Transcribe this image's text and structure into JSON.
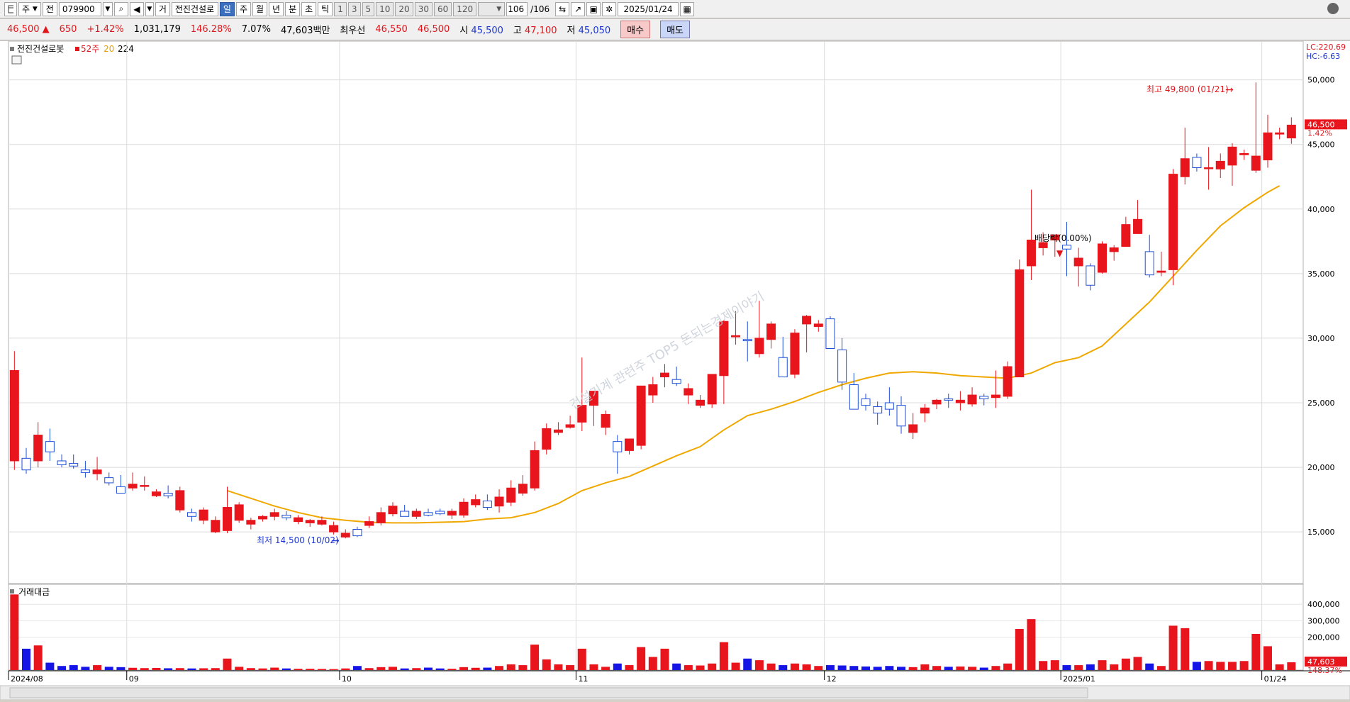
{
  "toolbar": {
    "mode1": "주",
    "mode2": "전",
    "code": "079900",
    "kind": "거",
    "name": "전진건설로",
    "periods": [
      "일",
      "주",
      "월",
      "년",
      "분",
      "초",
      "틱"
    ],
    "selected_period": "일",
    "minute_options": [
      "1",
      "3",
      "5",
      "10",
      "20",
      "30",
      "60",
      "120"
    ],
    "count": "106",
    "count_total": "/106",
    "date": "2025/01/24"
  },
  "quote": {
    "price": "46,500",
    "arrow": "▲",
    "change": "650",
    "change_pct": "+1.42%",
    "volume": "1,031,179",
    "volume_pct": "146.28%",
    "turnover_pct": "7.07%",
    "amount": "47,603백만",
    "best_label": "최우선",
    "best_ask": "46,550",
    "best_bid": "46,500",
    "open_label": "시",
    "open": "45,500",
    "high_label": "고",
    "high": "47,100",
    "low_label": "저",
    "low": "45,050",
    "buy_label": "매수",
    "sell_label": "매도"
  },
  "legend": {
    "name": "전진건설로봇",
    "ma1": "52주",
    "ma2": "20",
    "ma3": "224"
  },
  "labels": {
    "lc": "LC:220.69",
    "hc": "HC:-6.63",
    "last_price": "46,500",
    "last_pct": "1.42%",
    "max_note": "최고 49,800 (01/21)",
    "min_note": "최저 14,500 (10/02)",
    "dividend": "배당락(0.00%)",
    "watermark": "건설기계 관련주 TOP5 돈되는경제이야기",
    "volume_title": "거래대금",
    "vol_last": "47,603",
    "vol_pct": "148.37%"
  },
  "chart_data": {
    "type": "candlestick",
    "price_ticks": [
      15000,
      20000,
      25000,
      30000,
      35000,
      40000,
      45000,
      50000
    ],
    "price_tick_labels": [
      "15,000",
      "20,000",
      "25,000",
      "30,000",
      "35,000",
      "40,000",
      "45,000",
      "50,000"
    ],
    "ylim": [
      11000,
      53000
    ],
    "volume_ticks": [
      200000,
      300000,
      400000
    ],
    "volume_tick_labels": [
      "200,000",
      "300,000",
      "400,000"
    ],
    "volume_ylim": [
      0,
      470000
    ],
    "x_labels": [
      {
        "index": 0,
        "label": "2024/08"
      },
      {
        "index": 10,
        "label": "09"
      },
      {
        "index": 28,
        "label": "10"
      },
      {
        "index": 48,
        "label": "11"
      },
      {
        "index": 69,
        "label": "12"
      },
      {
        "index": 89,
        "label": "2025/01"
      },
      {
        "index": 106,
        "label": "01/24"
      }
    ],
    "candles": [
      [
        20500,
        29000,
        19800,
        27500,
        460000
      ],
      [
        20700,
        21500,
        19500,
        19800,
        130000
      ],
      [
        20500,
        23500,
        20000,
        22500,
        150000
      ],
      [
        22000,
        23000,
        20500,
        21200,
        45000
      ],
      [
        20500,
        21000,
        20000,
        20200,
        25000
      ],
      [
        20300,
        21000,
        19900,
        20100,
        30000
      ],
      [
        19800,
        20500,
        19200,
        19600,
        20000
      ],
      [
        19500,
        20800,
        19000,
        19800,
        30000
      ],
      [
        19200,
        19600,
        18600,
        18800,
        20000
      ],
      [
        18500,
        19400,
        18000,
        18000,
        18000
      ],
      [
        18400,
        19600,
        18200,
        18700,
        14000
      ],
      [
        18600,
        19300,
        18200,
        18600,
        12000
      ],
      [
        17800,
        18300,
        17700,
        18100,
        13000
      ],
      [
        18000,
        18600,
        17600,
        17800,
        11000
      ],
      [
        16700,
        18500,
        16500,
        18200,
        12000
      ],
      [
        16500,
        16800,
        15800,
        16200,
        10000
      ],
      [
        15900,
        16900,
        15600,
        16700,
        11000
      ],
      [
        15000,
        16200,
        14900,
        15900,
        12000
      ],
      [
        15100,
        18500,
        14900,
        16900,
        70000
      ],
      [
        15900,
        17300,
        15700,
        17100,
        20000
      ],
      [
        15600,
        16100,
        15200,
        15900,
        12000
      ],
      [
        16000,
        16300,
        15800,
        16200,
        10000
      ],
      [
        16200,
        16800,
        15900,
        16500,
        15000
      ],
      [
        16300,
        16600,
        15900,
        16100,
        10000
      ],
      [
        15800,
        16300,
        15600,
        16100,
        8000
      ],
      [
        15700,
        16000,
        15400,
        15900,
        8000
      ],
      [
        15600,
        16200,
        15500,
        15900,
        7000
      ],
      [
        15000,
        15800,
        14800,
        15500,
        6000
      ],
      [
        14600,
        15200,
        14500,
        14900,
        10000
      ],
      [
        15200,
        15400,
        14600,
        14700,
        25000
      ],
      [
        15500,
        16200,
        15300,
        15800,
        12000
      ],
      [
        15700,
        16900,
        15500,
        16500,
        18000
      ],
      [
        16400,
        17300,
        16200,
        17000,
        20000
      ],
      [
        16600,
        17100,
        16300,
        16200,
        10000
      ],
      [
        16200,
        16800,
        16000,
        16600,
        12000
      ],
      [
        16500,
        16800,
        16200,
        16300,
        15000
      ],
      [
        16600,
        16800,
        16300,
        16400,
        10000
      ],
      [
        16300,
        16800,
        16000,
        16600,
        8000
      ],
      [
        16300,
        17600,
        16100,
        17300,
        18000
      ],
      [
        17100,
        17900,
        16900,
        17500,
        14000
      ],
      [
        17400,
        17900,
        16700,
        16900,
        15000
      ],
      [
        17000,
        18300,
        16500,
        17700,
        25000
      ],
      [
        17300,
        19000,
        17000,
        18400,
        35000
      ],
      [
        18000,
        19400,
        17800,
        18700,
        30000
      ],
      [
        18400,
        22000,
        18200,
        21300,
        155000
      ],
      [
        21400,
        23400,
        21000,
        23000,
        65000
      ],
      [
        22700,
        23500,
        22500,
        22900,
        35000
      ],
      [
        23100,
        24000,
        23000,
        23300,
        30000
      ],
      [
        23500,
        28500,
        22800,
        24800,
        130000
      ],
      [
        24800,
        25400,
        23200,
        25900,
        35000
      ],
      [
        23100,
        24400,
        22500,
        24100,
        20000
      ],
      [
        22000,
        22500,
        19500,
        21200,
        40000
      ],
      [
        21300,
        22000,
        21000,
        22200,
        30000
      ],
      [
        21700,
        26000,
        21400,
        26300,
        140000
      ],
      [
        25600,
        27000,
        25000,
        26400,
        80000
      ],
      [
        27000,
        28000,
        26200,
        27300,
        130000
      ],
      [
        26800,
        27800,
        26300,
        26500,
        40000
      ],
      [
        25600,
        26500,
        24900,
        26100,
        30000
      ],
      [
        24800,
        25600,
        24600,
        25200,
        28000
      ],
      [
        24900,
        27000,
        24600,
        27200,
        40000
      ],
      [
        27100,
        31400,
        24900,
        31300,
        170000
      ],
      [
        30100,
        32100,
        29500,
        30200,
        45000
      ],
      [
        29900,
        31300,
        28200,
        29800,
        70000
      ],
      [
        28800,
        32900,
        28500,
        30000,
        60000
      ],
      [
        29900,
        31300,
        29200,
        31100,
        40000
      ],
      [
        28500,
        30100,
        27400,
        27000,
        30000
      ],
      [
        27200,
        30700,
        26900,
        30400,
        40000
      ],
      [
        31100,
        31800,
        28900,
        31700,
        35000
      ],
      [
        30900,
        31400,
        30500,
        31100,
        25000
      ],
      [
        31500,
        31700,
        29800,
        29200,
        30000
      ],
      [
        29100,
        30000,
        26000,
        26600,
        28000
      ],
      [
        26400,
        27300,
        24600,
        24500,
        25000
      ],
      [
        25300,
        25700,
        24400,
        24800,
        22000
      ],
      [
        24700,
        25100,
        23300,
        24200,
        20000
      ],
      [
        25000,
        26200,
        24000,
        24500,
        25000
      ],
      [
        24800,
        25500,
        22600,
        23200,
        20000
      ],
      [
        22700,
        24200,
        22200,
        23300,
        18000
      ],
      [
        24200,
        24900,
        23500,
        24600,
        35000
      ],
      [
        24900,
        25300,
        24500,
        25200,
        25000
      ],
      [
        25300,
        25700,
        24600,
        25200,
        20000
      ],
      [
        25000,
        25900,
        24400,
        25200,
        22000
      ],
      [
        24900,
        26200,
        24700,
        25600,
        20000
      ],
      [
        25500,
        25700,
        24800,
        25300,
        15000
      ],
      [
        25400,
        27500,
        24600,
        25600,
        25000
      ],
      [
        25500,
        28200,
        25300,
        27800,
        40000
      ],
      [
        27000,
        36100,
        27000,
        35300,
        250000
      ],
      [
        35600,
        41500,
        34500,
        37600,
        310000
      ],
      [
        37000,
        38200,
        36400,
        37400,
        55000
      ],
      [
        37600,
        37900,
        36300,
        38000,
        60000
      ],
      [
        37200,
        39000,
        34800,
        36900,
        30000
      ],
      [
        35600,
        37000,
        34000,
        36200,
        30000
      ],
      [
        35600,
        35800,
        33700,
        34100,
        35000
      ],
      [
        35100,
        37500,
        35000,
        37300,
        60000
      ],
      [
        36700,
        37200,
        36000,
        37000,
        35000
      ],
      [
        37100,
        39400,
        37200,
        38800,
        70000
      ],
      [
        38100,
        40700,
        38300,
        39200,
        80000
      ],
      [
        36700,
        38000,
        34700,
        34900,
        40000
      ],
      [
        35100,
        36700,
        34800,
        35200,
        25000
      ],
      [
        35300,
        43100,
        34100,
        42700,
        270000
      ],
      [
        42500,
        46300,
        41900,
        43900,
        255000
      ],
      [
        44000,
        44300,
        42900,
        43200,
        50000
      ],
      [
        43200,
        44800,
        41500,
        43200,
        55000
      ],
      [
        43100,
        44300,
        42400,
        43700,
        50000
      ],
      [
        43400,
        45100,
        41800,
        44800,
        50000
      ],
      [
        44200,
        44600,
        43800,
        44300,
        55000
      ],
      [
        43000,
        49800,
        42800,
        44100,
        220000
      ],
      [
        43800,
        47300,
        43200,
        45900,
        145000
      ],
      [
        45800,
        46300,
        45400,
        45900,
        35000
      ],
      [
        45500,
        47100,
        45050,
        46500,
        47603
      ]
    ],
    "ma20": [
      [
        18,
        18200
      ],
      [
        20,
        17600
      ],
      [
        22,
        17000
      ],
      [
        24,
        16500
      ],
      [
        26,
        16100
      ],
      [
        28,
        15900
      ],
      [
        30,
        15750
      ],
      [
        32,
        15700
      ],
      [
        34,
        15700
      ],
      [
        36,
        15750
      ],
      [
        38,
        15800
      ],
      [
        40,
        16000
      ],
      [
        42,
        16100
      ],
      [
        44,
        16500
      ],
      [
        46,
        17200
      ],
      [
        48,
        18200
      ],
      [
        50,
        18800
      ],
      [
        52,
        19300
      ],
      [
        54,
        20100
      ],
      [
        56,
        20900
      ],
      [
        58,
        21600
      ],
      [
        60,
        22900
      ],
      [
        62,
        24000
      ],
      [
        64,
        24500
      ],
      [
        66,
        25100
      ],
      [
        68,
        25800
      ],
      [
        70,
        26400
      ],
      [
        72,
        26900
      ],
      [
        74,
        27300
      ],
      [
        76,
        27400
      ],
      [
        78,
        27300
      ],
      [
        80,
        27100
      ],
      [
        82,
        27000
      ],
      [
        84,
        26900
      ],
      [
        86,
        27300
      ],
      [
        88,
        28100
      ],
      [
        90,
        28500
      ],
      [
        92,
        29400
      ],
      [
        94,
        31100
      ],
      [
        96,
        32800
      ],
      [
        98,
        34800
      ],
      [
        100,
        36800
      ],
      [
        102,
        38700
      ],
      [
        104,
        40100
      ],
      [
        106,
        41300
      ],
      [
        107,
        41800
      ]
    ]
  }
}
